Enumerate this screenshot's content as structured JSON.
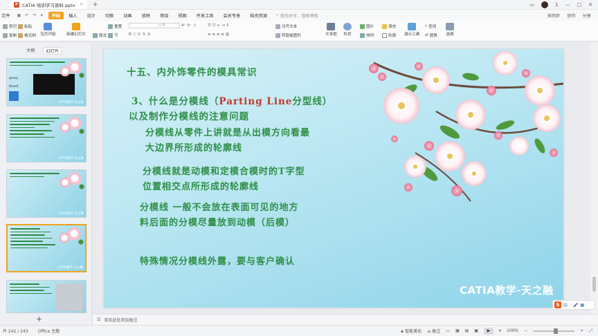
{
  "window": {
    "tab_title": "CATIA 培训学习资料.pptx",
    "tab_icon": "ppt-icon",
    "new_tab": "+",
    "controls": [
      "1",
      "—",
      "▢",
      "✕"
    ]
  },
  "menu": {
    "file": "文件",
    "items": [
      "开始",
      "插入",
      "设计",
      "切换",
      "动画",
      "放映",
      "审阅",
      "视图",
      "开发工具",
      "会员专享",
      "稻壳资源"
    ],
    "active_index": 0,
    "search_placeholder": "查找命令、搜索模板",
    "right": [
      "未同步",
      "协作",
      "分享"
    ]
  },
  "ribbon": {
    "cut": "剪切",
    "copy": "复制",
    "format_painter": "格式刷",
    "paste": "粘贴",
    "start_slideshow": "当页开始",
    "new_slide": "新建幻灯片",
    "layout": "版式",
    "section": "节",
    "reset": "重置",
    "font_size": "0",
    "text_tool": "文本框",
    "shape": "形状",
    "arrange": "排列",
    "picture": "图片",
    "fill": "填充",
    "outline": "轮廓",
    "find": "查找",
    "replace": "替换",
    "select": "选择",
    "present_tools": "演示工具",
    "convert_smartart": "转智能图形",
    "align_text": "对齐文本"
  },
  "left_panel": {
    "tabs": [
      "大纲",
      "幻灯片"
    ],
    "active_tab": 1,
    "thumbnails": [
      {
        "num": "",
        "watermark": "CATIA教学-天之融"
      },
      {
        "num": "",
        "watermark": "CATIA教学-天之融"
      },
      {
        "num": "",
        "watermark": "CATIA教学-天之融"
      },
      {
        "num": "",
        "watermark": "CATIA教学-天之融"
      },
      {
        "num": "",
        "watermark": ""
      }
    ],
    "selected_index": 3,
    "thumb1_labels": [
      "group",
      "Boss0"
    ],
    "add_button": "+"
  },
  "slide": {
    "title": "十五、内外饰零件的模具常识",
    "sub1_pre": "3、什么是分模线（",
    "sub1_en": "Parting Line",
    "sub1_post": "分型线）",
    "sub2": "以及制作分模线的注意问题",
    "p1a": "分模线从零件上讲就是从出模方向看最",
    "p1b": "大边界所形成的轮廓线",
    "p2a": "分模线就是动模和定模合模时的T字型",
    "p2b": "位置相交点所形成的轮廓线",
    "p3a": "分模线 一般不会放在表面可见的地方",
    "p3b": "料后面的分模尽量放到动模（后模）",
    "p4": "特殊情况分模线外露，要与客户确认",
    "watermark": "CATIA教学-天之融"
  },
  "notes": {
    "placeholder": "单击此处添加备注"
  },
  "status": {
    "slide_counter": "片 242 / 243",
    "theme": "Office 主题",
    "beautify": "智能美化",
    "notes_label": "备注",
    "zoom": "109%",
    "zoom_fraction": 0.55
  },
  "ime": {
    "logo": "S",
    "items": [
      "中",
      "·",
      "🎤",
      "▦"
    ]
  },
  "colors": {
    "accent": "#f0a31d",
    "slide_text": "#2e8f46",
    "slide_en": "#c0392b"
  }
}
